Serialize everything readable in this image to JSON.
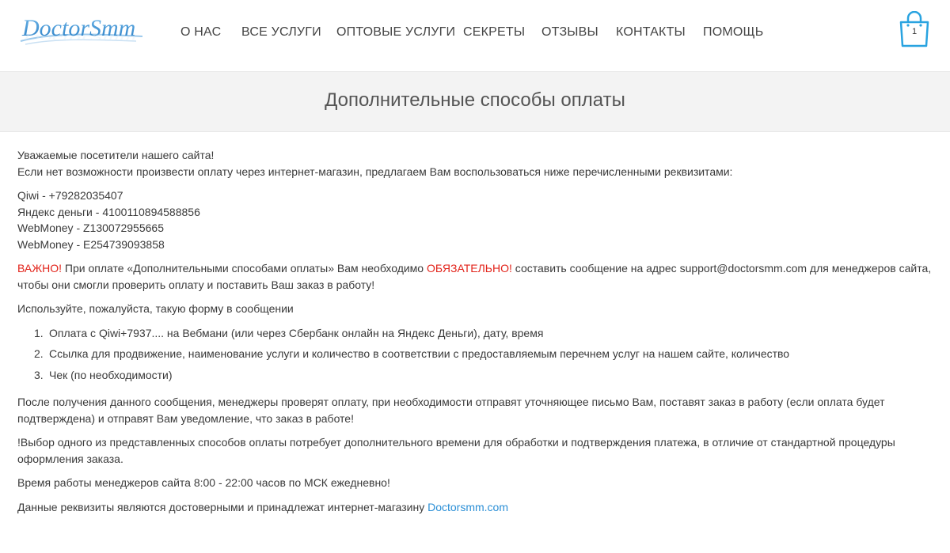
{
  "header": {
    "logo_text": "DoctorSmm",
    "nav": [
      {
        "label": "О НАС"
      },
      {
        "label": "ВСЕ УСЛУГИ"
      },
      {
        "label": "ОПТОВЫЕ УСЛУГИ"
      },
      {
        "label": "СЕКРЕТЫ"
      },
      {
        "label": "ОТЗЫВЫ"
      },
      {
        "label": "КОНТАКТЫ"
      },
      {
        "label": "ПОМОЩЬ"
      }
    ],
    "cart": {
      "icon": "shopping-bag-icon",
      "count": "1"
    }
  },
  "page_title": "Дополнительные способы оплаты",
  "content": {
    "greeting": "Уважаемые посетители нашего сайта!",
    "intro": "Если нет возможности произвести оплату через интернет-магазин, предлагаем Вам воспользоваться ниже перечисленными реквизитами:",
    "requisites": [
      "Qiwi - +79282035407",
      "Яндекс деньги - 4100110894588856",
      "WebMoney - Z130072955665",
      "WebMoney - E254739093858"
    ],
    "important": {
      "label": "ВАЖНО!",
      "text1": " При оплате «Дополнительными способами оплаты» Вам необходимо ",
      "mandatory": "ОБЯЗАТЕЛЬНО!",
      "text2": " составить сообщение на адрес support@doctorsmm.com для менеджеров сайта, чтобы они смогли проверить оплату и поставить Ваш заказ в работу!"
    },
    "form_intro": "Используйте, пожалуйста, такую форму в сообщении",
    "steps": [
      {
        "num": "1.",
        "text": "Оплата с Qiwi+7937.... на Вебмани (или через Сбербанк онлайн на Яндекс Деньги), дату, время"
      },
      {
        "num": "2.",
        "text": "Ссылка для продвижение, наименование услуги и количество в соответствии с предоставляемым перечнем услуг на нашем сайте, количество"
      },
      {
        "num": "3.",
        "text": "Чек (по необходимости)"
      }
    ],
    "after_message": "После получения данного сообщения, менеджеры проверят оплату, при необходимости отправят уточняющее письмо Вам, поставят заказ в работу (если оплата будет подтверждена) и отправят Вам уведомление, что заказ в работе!",
    "note": "!Выбор одного из представленных способов оплаты потребует дополнительного времени для обработки и подтверждения платежа, в отличие от стандартной процедуры оформления заказа.",
    "hours": "Время работы менеджеров сайта 8:00 - 22:00 часов по МСК ежедневно!",
    "footer_text": "Данные реквизиты являются достоверными и принадлежат интернет-магазину ",
    "footer_link": "Doctorsmm.com"
  },
  "colors": {
    "accent_red": "#e2231a",
    "link_blue": "#2b8fd6",
    "logo_blue": "#3a8fd0",
    "cart_blue": "#29a3e0"
  }
}
